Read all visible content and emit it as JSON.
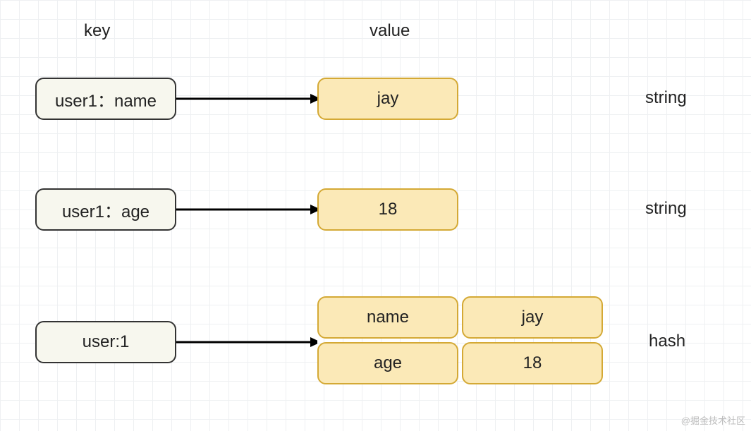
{
  "headers": {
    "key": "key",
    "value": "value"
  },
  "rows": [
    {
      "key": "user1：name",
      "value": "jay",
      "type": "string"
    },
    {
      "key": "user1：age",
      "value": "18",
      "type": "string"
    }
  ],
  "hash": {
    "key": "user:1",
    "type": "hash",
    "fields": [
      {
        "field": "name",
        "val": "jay"
      },
      {
        "field": "age",
        "val": "18"
      }
    ]
  },
  "watermark": "@掘金技术社区"
}
